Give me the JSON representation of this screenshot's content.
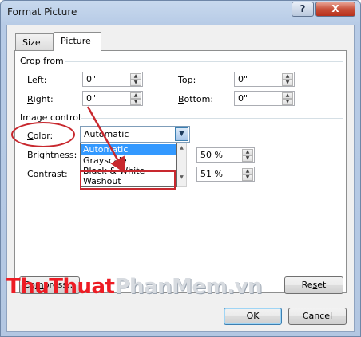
{
  "window": {
    "title": "Format Picture",
    "help_label": "?",
    "close_label": "X"
  },
  "tabs": [
    {
      "label": "Size"
    },
    {
      "label": "Picture"
    }
  ],
  "crop": {
    "section_label": "Crop from",
    "left": {
      "prefix": "",
      "accel": "L",
      "suffix": "eft:",
      "value": "0\""
    },
    "right": {
      "prefix": "",
      "accel": "R",
      "suffix": "ight:",
      "value": "0\""
    },
    "top": {
      "prefix": "",
      "accel": "T",
      "suffix": "op:",
      "value": "0\""
    },
    "bottom": {
      "prefix": "",
      "accel": "B",
      "suffix": "ottom:",
      "value": "0\""
    }
  },
  "image_control": {
    "section_label": "Image control",
    "color_label": {
      "prefix": "",
      "accel": "C",
      "suffix": "olor:"
    },
    "color_value": "Automatic",
    "color_options": [
      "Automatic",
      "Grayscale",
      "Black & White",
      "Washout"
    ],
    "selected_option": "Automatic",
    "brightness_label": {
      "prefix": "Bri",
      "accel": "g",
      "suffix": "htness:"
    },
    "brightness_value": "50 %",
    "contrast_label": {
      "prefix": "Co",
      "accel": "n",
      "suffix": "trast:"
    },
    "contrast_value": "51 %"
  },
  "buttons": {
    "compress": {
      "prefix": "Co",
      "accel": "m",
      "suffix": "press..."
    },
    "reset": {
      "prefix": "Re",
      "accel": "s",
      "suffix": "et"
    },
    "ok": "OK",
    "cancel": "Cancel"
  },
  "watermark": {
    "part1": "ThuThuat",
    "part2": "PhanMem.vn"
  },
  "colors": {
    "annotation": "#c8282e",
    "selection": "#3399ff",
    "watermark_red": "#ed1c24"
  }
}
